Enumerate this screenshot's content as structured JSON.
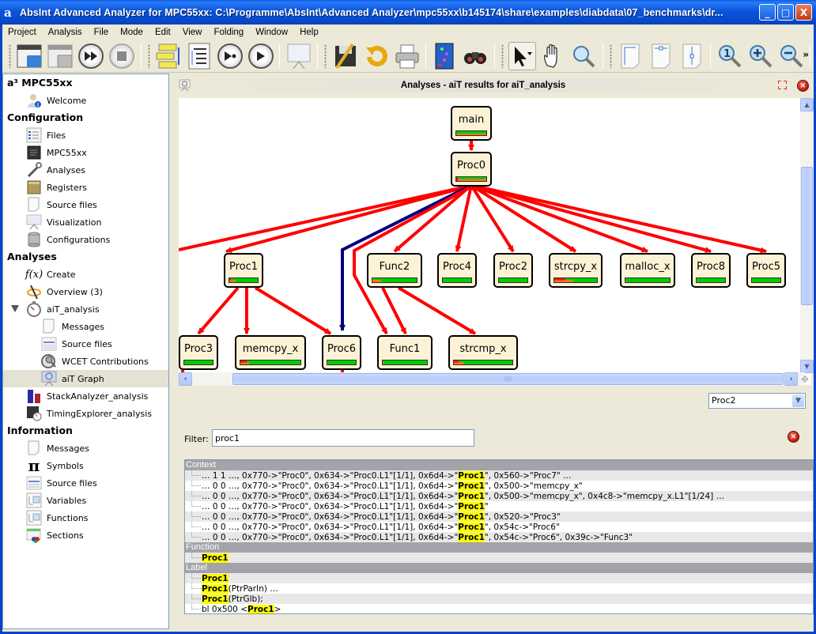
{
  "window": {
    "title": "AbsInt Advanced Analyzer for MPC55xx: C:\\Programme\\AbsInt\\Advanced Analyzer\\mpc55xx\\b145174\\share\\examples\\diabdata\\07_benchmarks\\dr...",
    "app_icon": "a",
    "controls": {
      "minimize": "_",
      "maximize": "□",
      "close": "X"
    }
  },
  "menu": [
    "Project",
    "Analysis",
    "File",
    "Mode",
    "Edit",
    "View",
    "Folding",
    "Window",
    "Help"
  ],
  "toolbar": {
    "groups": [
      [
        "open-project",
        "save-project",
        "run-all",
        "stop"
      ],
      [
        "call-graph-layout",
        "tree-view",
        "run-step",
        "run"
      ],
      [
        "presentation"
      ],
      [
        "edit-save",
        "reload",
        "print"
      ],
      [
        "book",
        "binoculars"
      ],
      [
        "select-pointer",
        "pan-hand",
        "magnifier"
      ],
      [
        "fit-page",
        "fit-width",
        "fit-height"
      ],
      [
        "zoom-reset",
        "zoom-in",
        "zoom-out"
      ]
    ],
    "overflow": "»"
  },
  "sidebar": {
    "sections": [
      {
        "title": "a³ MPC55xx",
        "items": [
          {
            "label": "Welcome",
            "icon": "user-info-icon",
            "level": 1
          }
        ]
      },
      {
        "title": "Configuration",
        "items": [
          {
            "label": "Files",
            "icon": "files-icon",
            "level": 1
          },
          {
            "label": "MPC55xx",
            "icon": "chip-icon",
            "level": 1
          },
          {
            "label": "Analyses",
            "icon": "wrench-icon",
            "level": 1
          },
          {
            "label": "Registers",
            "icon": "registers-icon",
            "level": 1
          },
          {
            "label": "Source files",
            "icon": "document-icon",
            "level": 1
          },
          {
            "label": "Visualization",
            "icon": "presentation-icon",
            "level": 1
          },
          {
            "label": "Configurations",
            "icon": "database-icon",
            "level": 1
          }
        ]
      },
      {
        "title": "Analyses",
        "items": [
          {
            "label": "Create",
            "icon": "function-icon",
            "level": 1
          },
          {
            "label": "Overview (3)",
            "icon": "overview-icon",
            "level": 1
          },
          {
            "label": "aiT_analysis",
            "icon": "stopwatch-icon",
            "level": 1,
            "expanded": true
          },
          {
            "label": "Messages",
            "icon": "document-icon",
            "level": 2
          },
          {
            "label": "Source files",
            "icon": "source-list-icon",
            "level": 2
          },
          {
            "label": "WCET Contributions",
            "icon": "wcet-icon",
            "level": 2
          },
          {
            "label": "aiT Graph",
            "icon": "graph-icon",
            "level": 2,
            "selected": true
          },
          {
            "label": "StackAnalyzer_analysis",
            "icon": "bar-chart-icon",
            "level": 1
          },
          {
            "label": "TimingExplorer_analysis",
            "icon": "chip-stopwatch-icon",
            "level": 1
          }
        ]
      },
      {
        "title": "Information",
        "items": [
          {
            "label": "Messages",
            "icon": "document-icon",
            "level": 1
          },
          {
            "label": "Symbols",
            "icon": "pi-icon",
            "level": 1
          },
          {
            "label": "Source files",
            "icon": "source-list-icon",
            "level": 1
          },
          {
            "label": "Variables",
            "icon": "table-icon",
            "level": 1
          },
          {
            "label": "Functions",
            "icon": "table-icon",
            "level": 1
          },
          {
            "label": "Sections",
            "icon": "sections-icon",
            "level": 1
          }
        ]
      }
    ]
  },
  "panel": {
    "title": "Analyses - aiT results for aiT_analysis"
  },
  "graph": {
    "nodes": [
      {
        "id": "main",
        "label": "main",
        "red": 0,
        "orange": 0.02,
        "orange_bg": true
      },
      {
        "id": "Proc0",
        "label": "Proc0",
        "red": 0.04,
        "orange": 0.96,
        "orange_split": true
      },
      {
        "id": "Proc1",
        "label": "Proc1",
        "red": 0.05,
        "orange": 0.18
      },
      {
        "id": "Func2",
        "label": "Func2",
        "red": 0,
        "orange": 0.2
      },
      {
        "id": "Proc4",
        "label": "Proc4",
        "red": 0,
        "orange": 0
      },
      {
        "id": "Proc2",
        "label": "Proc2",
        "red": 0,
        "orange": 0
      },
      {
        "id": "strcpy_x",
        "label": "strcpy_x",
        "red": 0.25,
        "orange": 0.2
      },
      {
        "id": "malloc_x",
        "label": "malloc_x",
        "red": 0,
        "orange": 0.02
      },
      {
        "id": "Proc8",
        "label": "Proc8",
        "red": 0,
        "orange": 0.02
      },
      {
        "id": "Proc5",
        "label": "Proc5",
        "red": 0,
        "orange": 0
      },
      {
        "id": "Proc3",
        "label": "Proc3",
        "red": 0,
        "orange": 0
      },
      {
        "id": "memcpy_x",
        "label": "memcpy_x",
        "red": 0.1,
        "orange": 0.05
      },
      {
        "id": "Proc6",
        "label": "Proc6",
        "red": 0,
        "orange": 0.03
      },
      {
        "id": "Func1",
        "label": "Func1",
        "red": 0,
        "orange": 0.02
      },
      {
        "id": "strcmp_x",
        "label": "strcmp_x",
        "red": 0.08,
        "orange": 0.1
      }
    ],
    "edges": [
      {
        "from": "main",
        "to": "Proc0",
        "color": "red"
      },
      {
        "from": "Proc0",
        "to": "Proc1",
        "color": "red"
      },
      {
        "from": "Proc0",
        "to": "offscreen-left",
        "color": "red"
      },
      {
        "from": "Proc0",
        "to": "Proc6",
        "color": "blue"
      },
      {
        "from": "Proc0",
        "to": "Func1",
        "color": "red"
      },
      {
        "from": "Proc0",
        "to": "Func2",
        "color": "red"
      },
      {
        "from": "Proc0",
        "to": "Proc4",
        "color": "red"
      },
      {
        "from": "Proc0",
        "to": "Proc2",
        "color": "red"
      },
      {
        "from": "Proc0",
        "to": "strcpy_x",
        "color": "red"
      },
      {
        "from": "Proc0",
        "to": "malloc_x",
        "color": "red"
      },
      {
        "from": "Proc0",
        "to": "Proc8",
        "color": "red"
      },
      {
        "from": "Proc0",
        "to": "Proc5",
        "color": "red"
      },
      {
        "from": "Proc1",
        "to": "Proc3",
        "color": "red"
      },
      {
        "from": "Proc1",
        "to": "memcpy_x",
        "color": "red"
      },
      {
        "from": "Proc1",
        "to": "Proc6",
        "color": "red"
      },
      {
        "from": "Func2",
        "to": "Func1",
        "color": "red"
      },
      {
        "from": "Func2",
        "to": "strcmp_x",
        "color": "red"
      }
    ],
    "colors": {
      "edge_red": "#ff0000",
      "edge_blue": "#000080",
      "node_fill": "#fdf2d6",
      "bar_green": "#00cc00",
      "bar_red": "#f01010",
      "bar_orange": "#f07818"
    }
  },
  "function_select": {
    "value": "Proc2"
  },
  "filter": {
    "label": "Filter:",
    "value": "proc1"
  },
  "results": {
    "highlight": "Proc1",
    "groups": [
      {
        "title": "Context",
        "rows": [
          {
            "pre": "… 1 1 …, 0x770->\"Proc0\", 0x634->\"Proc0.L1\"[1/1], 0x6d4->\"",
            "hl": "Proc1",
            "post": "\", 0x560->\"Proc7\" …"
          },
          {
            "pre": "… 0 0 …, 0x770->\"Proc0\", 0x634->\"Proc0.L1\"[1/1], 0x6d4->\"",
            "hl": "Proc1",
            "post": "\", 0x500->\"memcpy_x\""
          },
          {
            "pre": "… 0 0 …, 0x770->\"Proc0\", 0x634->\"Proc0.L1\"[1/1], 0x6d4->\"",
            "hl": "Proc1",
            "post": "\", 0x500->\"memcpy_x\", 0x4c8->\"memcpy_x.L1\"[1/24] …"
          },
          {
            "pre": "… 0 0 …, 0x770->\"Proc0\", 0x634->\"Proc0.L1\"[1/1], 0x6d4->\"",
            "hl": "Proc1",
            "post": "\""
          },
          {
            "pre": "… 0 0 …, 0x770->\"Proc0\", 0x634->\"Proc0.L1\"[1/1], 0x6d4->\"",
            "hl": "Proc1",
            "post": "\", 0x520->\"Proc3\""
          },
          {
            "pre": "… 0 0 …, 0x770->\"Proc0\", 0x634->\"Proc0.L1\"[1/1], 0x6d4->\"",
            "hl": "Proc1",
            "post": "\", 0x54c->\"Proc6\""
          },
          {
            "pre": "… 0 0 …, 0x770->\"Proc0\", 0x634->\"Proc0.L1\"[1/1], 0x6d4->\"",
            "hl": "Proc1",
            "post": "\", 0x54c->\"Proc6\", 0x39c->\"Func3\""
          }
        ]
      },
      {
        "title": "Function",
        "rows": [
          {
            "pre": "",
            "hl": "Proc1",
            "post": ""
          }
        ]
      },
      {
        "title": "Label",
        "rows": [
          {
            "pre": "",
            "hl": "Proc1",
            "post": ""
          },
          {
            "pre": "",
            "hl": "Proc1",
            "post": "(PtrParIn) …"
          },
          {
            "pre": "",
            "hl": "Proc1",
            "post": "(PtrGlb);"
          },
          {
            "pre": "bl 0x500 <",
            "hl": "Proc1",
            "post": ">"
          }
        ]
      }
    ]
  }
}
